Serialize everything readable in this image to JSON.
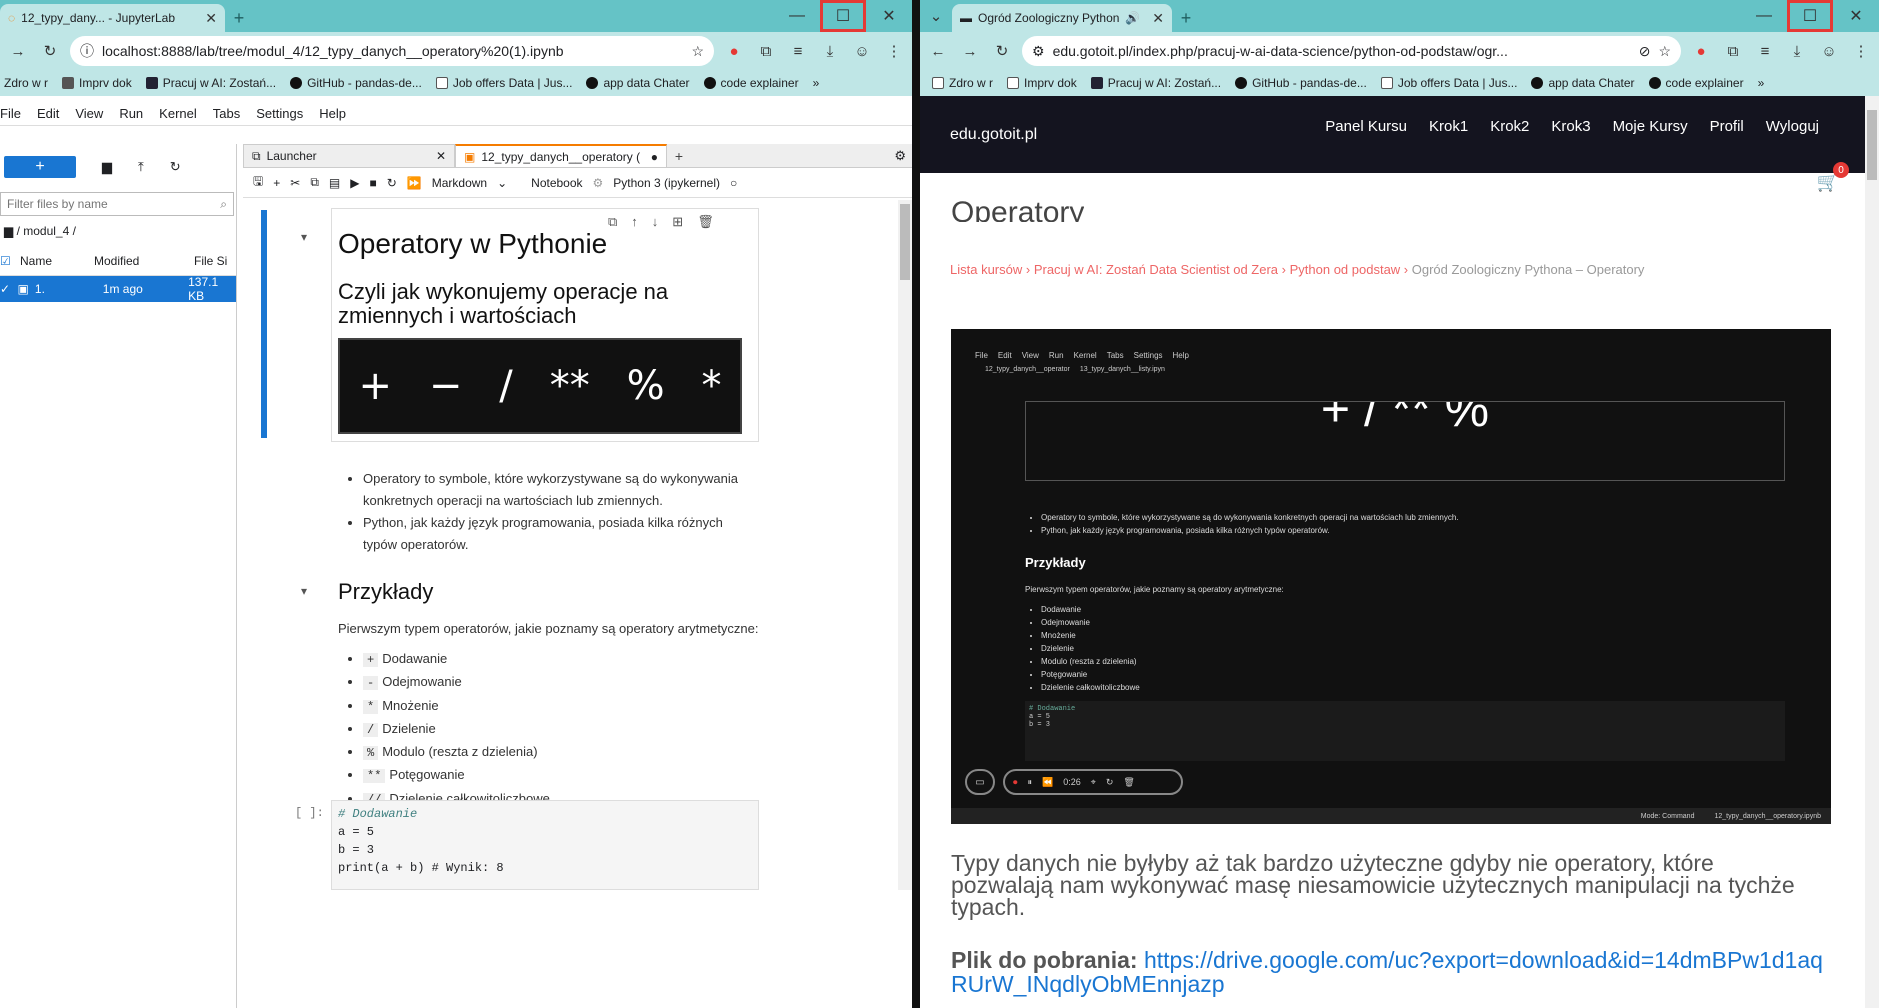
{
  "left": {
    "tab_title": "12_typy_dany... - JupyterLab",
    "url": "localhost:8888/lab/tree/modul_4/12_typy_danych__operatory%20(1).ipynb",
    "bookmarks": [
      "Zdro w r",
      "Imprv dok",
      "Pracuj w AI: Zostań...",
      "GitHub - pandas-de...",
      "Job offers Data | Jus...",
      "app data Chater",
      "code explainer"
    ],
    "menu": [
      "File",
      "Edit",
      "View",
      "Run",
      "Kernel",
      "Tabs",
      "Settings",
      "Help"
    ],
    "filter_placeholder": "Filter files by name",
    "folder": "/ modul_4 /",
    "col_name": "Name",
    "col_modified": "Modified",
    "col_size": "File Si",
    "file": {
      "name": "1.",
      "modified": "1m ago",
      "size": "137.1 KB"
    },
    "nb_tabs": [
      "Launcher",
      "12_typy_danych__operatory ("
    ],
    "cell_type": "Markdown",
    "notebook_label": "Notebook",
    "kernel": "Python 3 (ipykernel)",
    "h1": "Operatory w Pythonie",
    "h2": "Czyli jak wykonujemy operacje na zmiennych i wartościach",
    "ops_image": [
      "+",
      "−",
      "/",
      "**",
      "%",
      "*"
    ],
    "bullets": [
      "Operatory to symbole, które wykorzystywane są do wykonywania konkretnych operacji na wartościach lub zmiennych.",
      "Python, jak każdy język programowania, posiada kilka różnych typów operatorów."
    ],
    "examples_title": "Przykłady",
    "examples_intro": "Pierwszym typem operatorów, jakie poznamy są operatory arytmetyczne:",
    "ops": [
      {
        "sym": "+",
        "label": "Dodawanie"
      },
      {
        "sym": "-",
        "label": "Odejmowanie"
      },
      {
        "sym": "*",
        "label": "Mnożenie"
      },
      {
        "sym": "/",
        "label": "Dzielenie"
      },
      {
        "sym": "%",
        "label": "Modulo (reszta z dzielenia)"
      },
      {
        "sym": "**",
        "label": "Potęgowanie"
      },
      {
        "sym": "//",
        "label": "Dzielenie całkowitoliczbowe"
      }
    ],
    "prompt": "[ ]:",
    "code": [
      "# Dodawanie",
      "a = 5",
      "b = 3",
      "print(a + b)  # Wynik: 8"
    ]
  },
  "right": {
    "tab_title": "Ogród Zoologiczny Python",
    "url": "edu.gotoit.pl/index.php/pracuj-w-ai-data-science/python-od-podstaw/ogr...",
    "bookmarks": [
      "Zdro w r",
      "Imprv dok",
      "Pracuj w AI: Zostań...",
      "GitHub - pandas-de...",
      "Job offers Data | Jus...",
      "app data Chater",
      "code explainer"
    ],
    "brand": "edu.gotoit.pl",
    "nav": [
      "Panel Kursu",
      "Krok1",
      "Krok2",
      "Krok3",
      "Moje Kursy",
      "Profil",
      "Wyloguj"
    ],
    "cart_count": "0",
    "page_heading": "Operatory",
    "breadcrumb": [
      "Lista kursów",
      "Pracuj w AI: Zostań Data Scientist od Zera",
      "Python od podstaw",
      "Ogród Zoologiczny Pythona – Operatory"
    ],
    "video_menu": [
      "File",
      "Edit",
      "View",
      "Run",
      "Kernel",
      "Tabs",
      "Settings",
      "Help"
    ],
    "video_tabs": [
      "12_typy_danych__operator",
      "13_typy_danych__listy.ipyn"
    ],
    "video_bullets": [
      "Operatory to symbole, które wykorzystywane są do wykonywania konkretnych operacji na wartościach lub zmiennych.",
      "Python, jak każdy język programowania, posiada kilka różnych typów operatorów."
    ],
    "video_examples": "Przykłady",
    "video_intro": "Pierwszym typem operatorów, jakie poznamy są operatory arytmetyczne:",
    "video_ops": [
      "Dodawanie",
      "Odejmowanie",
      "Mnożenie",
      "Dzielenie",
      "Modulo (reszta z dzielenia)",
      "Potęgowanie",
      "Dzielenie całkowitoliczbowe"
    ],
    "video_time": "0:26",
    "video_status": "Mode: Command",
    "video_file": "12_typy_danych__operatory.ipynb",
    "paragraph": "Typy danych nie byłyby aż tak bardzo użyteczne gdyby nie operatory, które pozwalają nam wykonywać masę niesamowicie użytecznych manipulacji na tychże typach.",
    "download_label": "Plik do pobrania:",
    "download_link": "https://drive.google.com/uc?export=download&id=14dmBPw1d1aqRUrW_INqdlyObMEnnjazp"
  }
}
